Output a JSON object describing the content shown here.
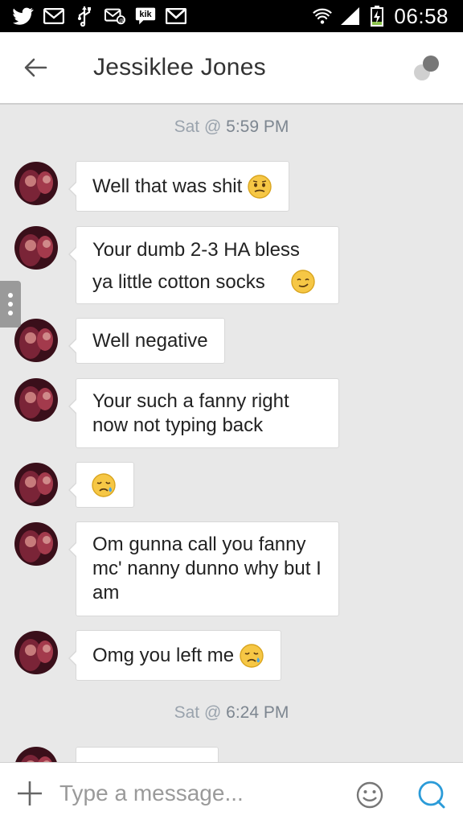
{
  "status_bar": {
    "time": "06:58",
    "kik_label": "kik",
    "left_icons": [
      "twitter-icon",
      "email-icon",
      "usb-icon",
      "email-sync-icon",
      "kik-icon",
      "gmail-icon"
    ],
    "right_icons": [
      "wifi-icon",
      "signal-icon",
      "battery-charging-icon"
    ]
  },
  "header": {
    "contact_name": "Jessiklee Jones",
    "back_icon": "back-arrow-icon",
    "status_icon": "typing-dots-icon"
  },
  "chat": {
    "date_separators": [
      {
        "day": "Sat @",
        "time": "5:59 PM"
      },
      {
        "day": "Sat @",
        "time": "6:24 PM"
      }
    ],
    "messages": [
      {
        "text": "Well that was shit",
        "emoji": "confused-face-emoji"
      },
      {
        "text": "Your dumb 2-3 HA bless ya little cotton socks",
        "emoji": "smirk-face-emoji"
      },
      {
        "text": "Well negative",
        "emoji": ""
      },
      {
        "text": "Your such a fanny right now not typing back",
        "emoji": ""
      },
      {
        "text": "",
        "emoji": "crying-face-emoji"
      },
      {
        "text": "Om gunna call you fanny mc' nanny dunno why but I am",
        "emoji": ""
      },
      {
        "text": "Omg you left me",
        "emoji": "crying-face-emoji"
      }
    ]
  },
  "input_bar": {
    "placeholder": "Type a message...",
    "icons": [
      "plus-icon",
      "smiley-icon",
      "send-icon"
    ]
  },
  "colors": {
    "background": "#e8e8e8",
    "header_bg": "#ffffff",
    "status_bar_bg": "#000000",
    "date_text": "#9aa3ad",
    "send_icon": "#2b9bd8"
  }
}
